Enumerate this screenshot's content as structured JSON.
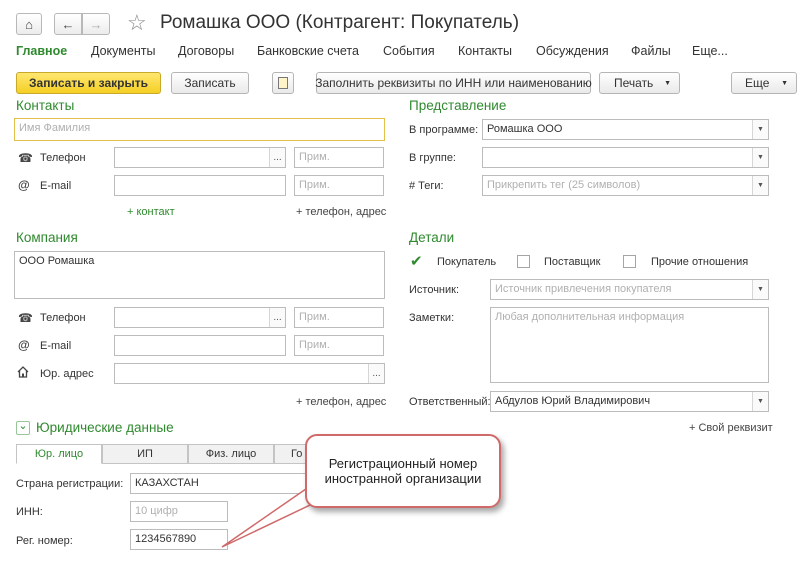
{
  "window": {
    "title": "Ромашка ООО (Контрагент: Покупатель)"
  },
  "nav": {
    "home": "⌂",
    "back": "←",
    "forward": "→",
    "star": "☆"
  },
  "tabs": [
    "Главное",
    "Документы",
    "Договоры",
    "Банковские счета",
    "События",
    "Контакты",
    "Обсуждения",
    "Файлы",
    "Еще..."
  ],
  "toolbar": {
    "save_close": "Записать и закрыть",
    "save": "Записать",
    "fill": "Заполнить реквизиты по ИНН или наименованию",
    "print": "Печать",
    "more": "Еще"
  },
  "contacts": {
    "heading": "Контакты",
    "name_placeholder": "Имя Фамилия",
    "phone_label": "Телефон",
    "email_label": "E-mail",
    "note_placeholder": "Прим.",
    "add_contact": "+ контакт",
    "add_phone_address": "+ телефон, адрес"
  },
  "presentation": {
    "heading": "Представление",
    "program_label": "В программе:",
    "program_value": "Ромашка ООО",
    "group_label": "В группе:",
    "tags_label": "# Теги:",
    "tags_placeholder": "Прикрепить тег (25 символов)"
  },
  "company": {
    "heading": "Компания",
    "name_value": "ООО Ромашка",
    "phone_label": "Телефон",
    "email_label": "E-mail",
    "address_label": "Юр. адрес",
    "note_placeholder": "Прим.",
    "add_phone_address": "+ телефон, адрес"
  },
  "details": {
    "heading": "Детали",
    "buyer_label": "Покупатель",
    "buyer_checked": true,
    "supplier_label": "Поставщик",
    "other_label": "Прочие отношения",
    "source_label": "Источник:",
    "source_placeholder": "Источник привлечения покупателя",
    "notes_label": "Заметки:",
    "notes_placeholder": "Любая дополнительная информация",
    "responsible_label": "Ответственный:",
    "responsible_value": "Абдулов Юрий Владимирович",
    "own_requisite": "+ Свой реквизит"
  },
  "legal": {
    "heading": "Юридические данные",
    "subtabs": [
      "Юр. лицо",
      "ИП",
      "Физ. лицо",
      "Го"
    ],
    "country_label": "Страна регистрации:",
    "country_value": "КАЗАХСТАН",
    "inn_label": "ИНН:",
    "inn_placeholder": "10 цифр",
    "reg_label": "Рег. номер:",
    "reg_value": "1234567890"
  },
  "callout": {
    "text": "Регистрационный номер иностранной организации"
  },
  "icons": {
    "phone": "☎",
    "email": "@",
    "address": "🏠",
    "chevron": "⌄",
    "dropdown": "▼",
    "check": "✔",
    "dots": "..."
  },
  "colors": {
    "accent": "#2f8a2f",
    "primary_button": "#f4cf24",
    "callout_border": "#d06a6a"
  }
}
